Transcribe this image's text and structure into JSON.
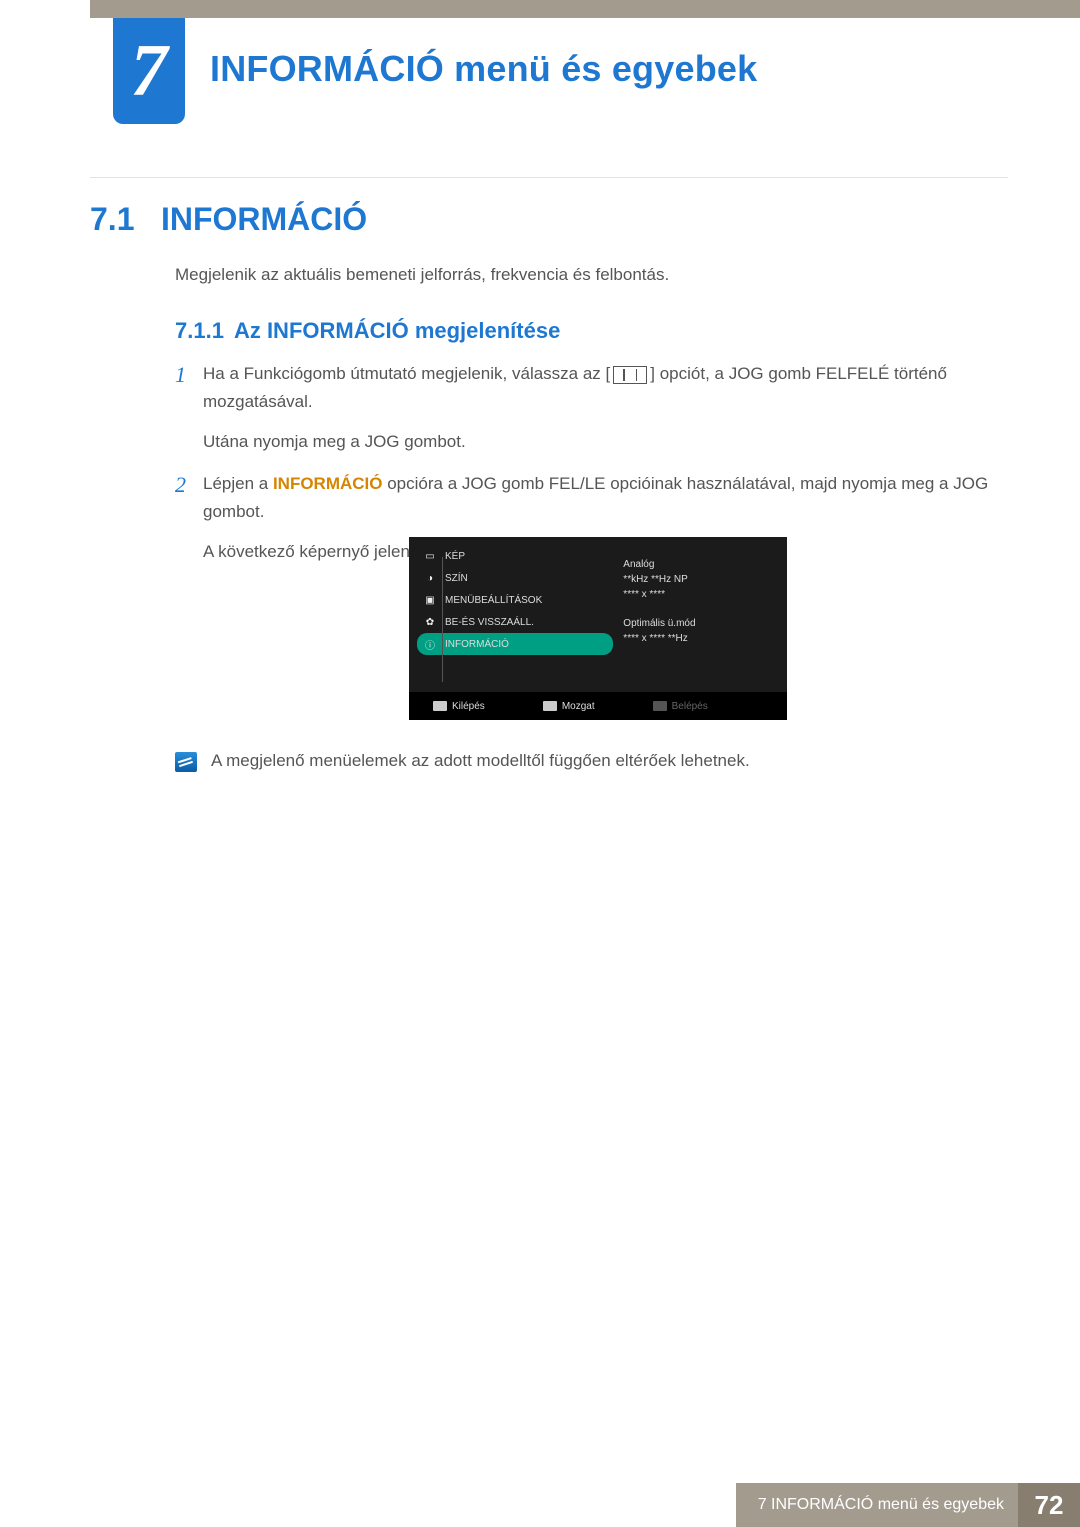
{
  "chapter": {
    "number": "7",
    "title": "INFORMÁCIÓ menü és egyebek"
  },
  "section": {
    "number": "7.1",
    "title": "INFORMÁCIÓ",
    "intro": "Megjelenik az aktuális bemeneti jelforrás, frekvencia és felbontás."
  },
  "subsection": {
    "number": "7.1.1",
    "title": "Az INFORMÁCIÓ megjelenítése"
  },
  "steps": {
    "s1": {
      "n": "1",
      "pre": "Ha a Funkciógomb útmutató megjelenik, válassza az [",
      "post": "] opciót, a JOG gomb FELFELÉ történő mozgatásával.",
      "sub": "Utána nyomja meg a JOG gombot."
    },
    "s2": {
      "n": "2",
      "t1": "Lépjen a ",
      "hl": "INFORMÁCIÓ",
      "t2": " opcióra a JOG gomb FEL/LE opcióinak használatával, majd nyomja meg a JOG gombot.",
      "sub": "A következő képernyő jelenik meg."
    }
  },
  "osd": {
    "menu": {
      "kep": "KÉP",
      "szin": "SZÍN",
      "menubeall": "MENÜBEÁLLÍTÁSOK",
      "bevis": "BE-ÉS VISSZAÁLL.",
      "info": "INFORMÁCIÓ"
    },
    "info": {
      "l1": "Analóg",
      "l2": "**kHz **Hz NP",
      "l3": "**** x ****",
      "l4": "Optimális ü.mód",
      "l5": "**** x **** **Hz"
    },
    "foot": {
      "exit": "Kilépés",
      "move": "Mozgat",
      "enter": "Belépés"
    }
  },
  "note": "A megjelenő menüelemek az adott modelltől függően eltérőek lehetnek.",
  "footer": {
    "label": "7 INFORMÁCIÓ menü és egyebek",
    "page": "72"
  }
}
